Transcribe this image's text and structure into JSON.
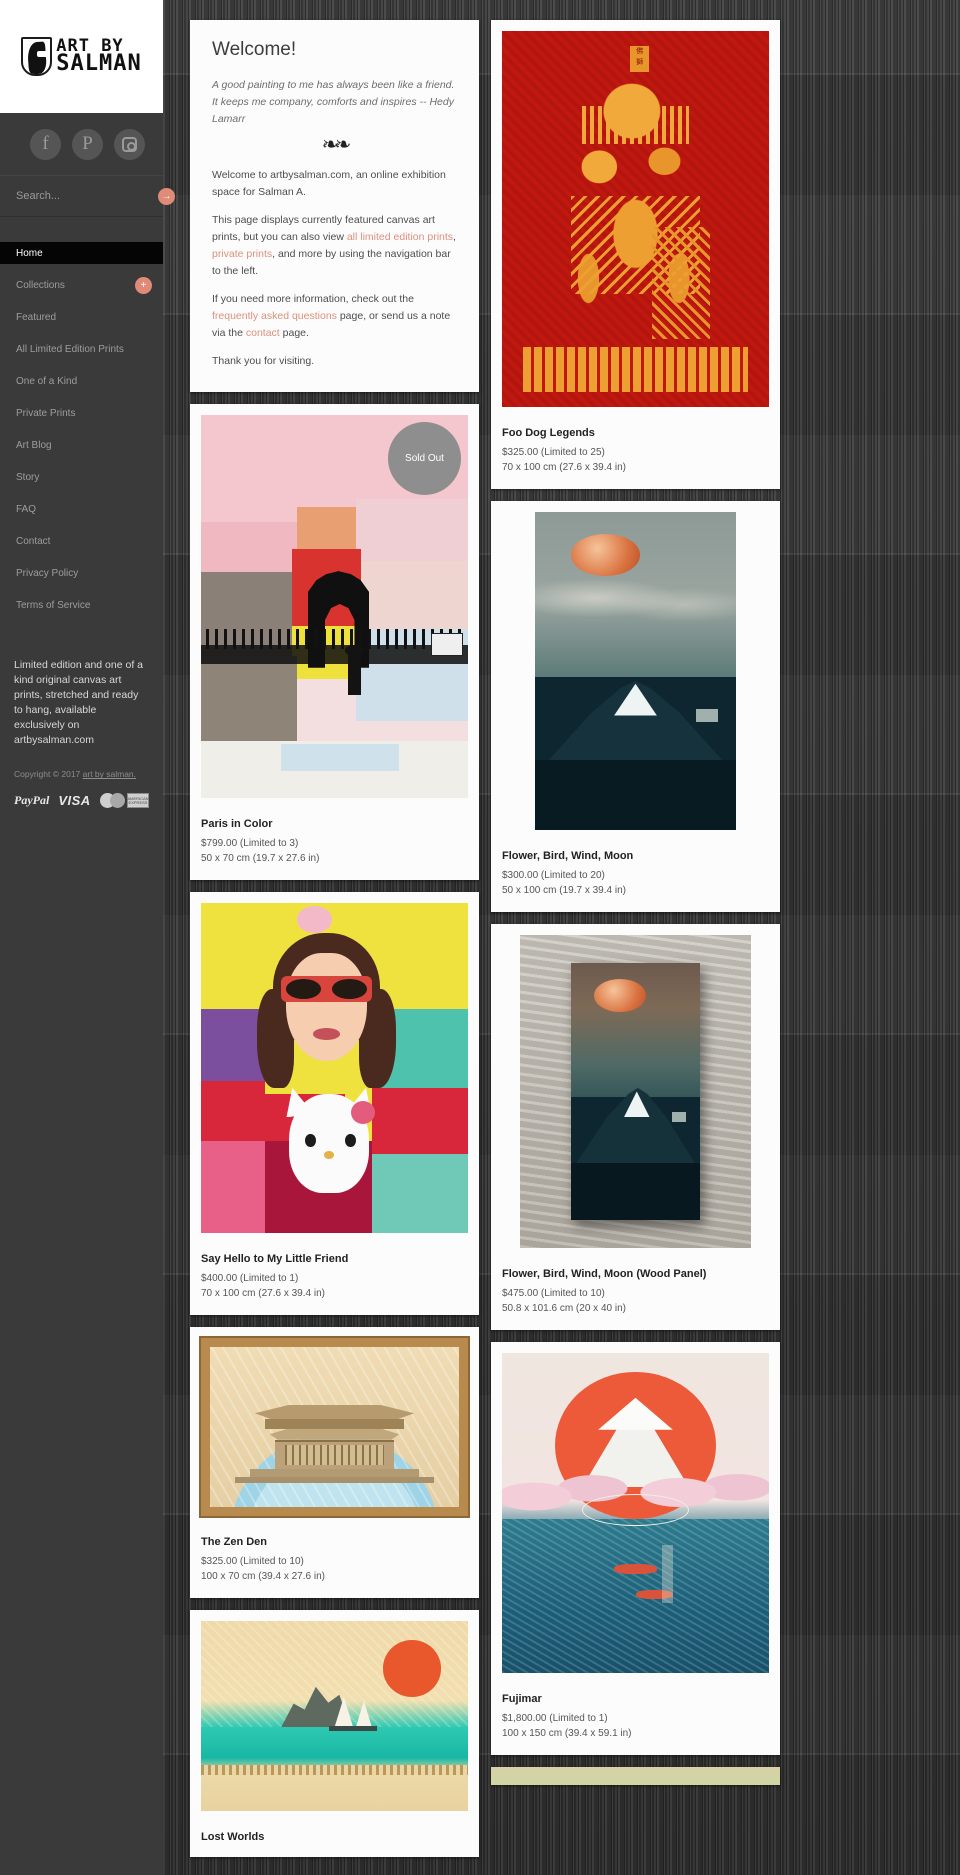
{
  "brand": {
    "line1": "ART BY",
    "line2": "SALMAN",
    "logo_icon": "shield-profile-logo"
  },
  "sidebar": {
    "social": [
      {
        "name": "facebook-icon",
        "glyph": "f"
      },
      {
        "name": "pinterest-icon",
        "glyph": "P"
      },
      {
        "name": "instagram-icon",
        "glyph": ""
      }
    ],
    "search": {
      "placeholder": "Search...",
      "value": "",
      "submit_label": "→"
    },
    "nav": [
      {
        "label": "Home",
        "active": true,
        "badge": ""
      },
      {
        "label": "Collections",
        "active": false,
        "badge": "+"
      },
      {
        "label": "Featured",
        "active": false,
        "badge": ""
      },
      {
        "label": "All Limited Edition Prints",
        "active": false,
        "badge": ""
      },
      {
        "label": "One of a Kind",
        "active": false,
        "badge": ""
      },
      {
        "label": "Private Prints",
        "active": false,
        "badge": ""
      },
      {
        "label": "Art Blog",
        "active": false,
        "badge": ""
      },
      {
        "label": "Story",
        "active": false,
        "badge": ""
      },
      {
        "label": "FAQ",
        "active": false,
        "badge": ""
      },
      {
        "label": "Contact",
        "active": false,
        "badge": ""
      },
      {
        "label": "Privacy Policy",
        "active": false,
        "badge": ""
      },
      {
        "label": "Terms of Service",
        "active": false,
        "badge": ""
      }
    ],
    "promo": "Limited edition and one of a kind original canvas art prints, stretched and ready to hang, available exclusively on artbysalman.com",
    "copyright_prefix": "Copyright © 2017 ",
    "copyright_link": "art by salman.",
    "payments": [
      "PayPal",
      "VISA",
      "MasterCard",
      "AMERICAN EXPRESS"
    ]
  },
  "welcome": {
    "heading": "Welcome!",
    "quote": "A good painting to me has always been like a friend. It keeps me company, comforts and inspires -- Hedy Lamarr",
    "p1": "Welcome to artbysalman.com, an online exhibition space for Salman A.",
    "p2_a": "This page displays currently featured canvas art prints, but you can also view ",
    "p2_link1": "all limited edition prints",
    "p2_b": ", ",
    "p2_link2": "private prints",
    "p2_c": ", and more by using the navigation bar to the left.",
    "p3_a": "If you need more information, check out the ",
    "p3_link1": "frequently asked questions",
    "p3_b": " page, or send us a note via the ",
    "p3_link2": "contact",
    "p3_c": " page.",
    "p4": "Thank you for visiting."
  },
  "badges": {
    "sold_out": "Sold Out"
  },
  "products": {
    "left": [
      {
        "title": "Paris in Color",
        "price": "$799.00 (Limited to 3)",
        "size": "50 x 70 cm (19.7 x 27.6 in)",
        "sold_out": true
      },
      {
        "title": "Say Hello to My Little Friend",
        "price": "$400.00 (Limited to 1)",
        "size": "70 x 100 cm (27.6 x 39.4 in)",
        "sold_out": false
      },
      {
        "title": "The Zen Den",
        "price": "$325.00 (Limited to 10)",
        "size": "100 x 70 cm (39.4 x 27.6 in)",
        "sold_out": false
      },
      {
        "title": "Lost Worlds",
        "price": "",
        "size": "",
        "sold_out": false
      }
    ],
    "right": [
      {
        "title": "Foo Dog Legends",
        "price": "$325.00 (Limited to 25)",
        "size": "70 x 100 cm (27.6 x 39.4 in)",
        "sold_out": false
      },
      {
        "title": "Flower, Bird, Wind, Moon",
        "price": "$300.00 (Limited to 20)",
        "size": "50 x 100 cm (19.7 x 39.4 in)",
        "sold_out": false
      },
      {
        "title": "Flower, Bird, Wind, Moon (Wood Panel)",
        "price": "$475.00 (Limited to 10)",
        "size": "50.8 x 101.6 cm (20 x 40 in)",
        "sold_out": false
      },
      {
        "title": "Fujimar",
        "price": "$1,800.00 (Limited to 1)",
        "size": "100 x 150 cm (39.4 x 59.1 in)",
        "sold_out": false
      }
    ]
  },
  "colors": {
    "accent": "#e08a78",
    "link": "#dd8f7b",
    "sidebar_bg": "#3a3a3a",
    "active_nav_bg": "#050505",
    "card_bg": "#fcfcfc",
    "page_bg": "#454545"
  }
}
